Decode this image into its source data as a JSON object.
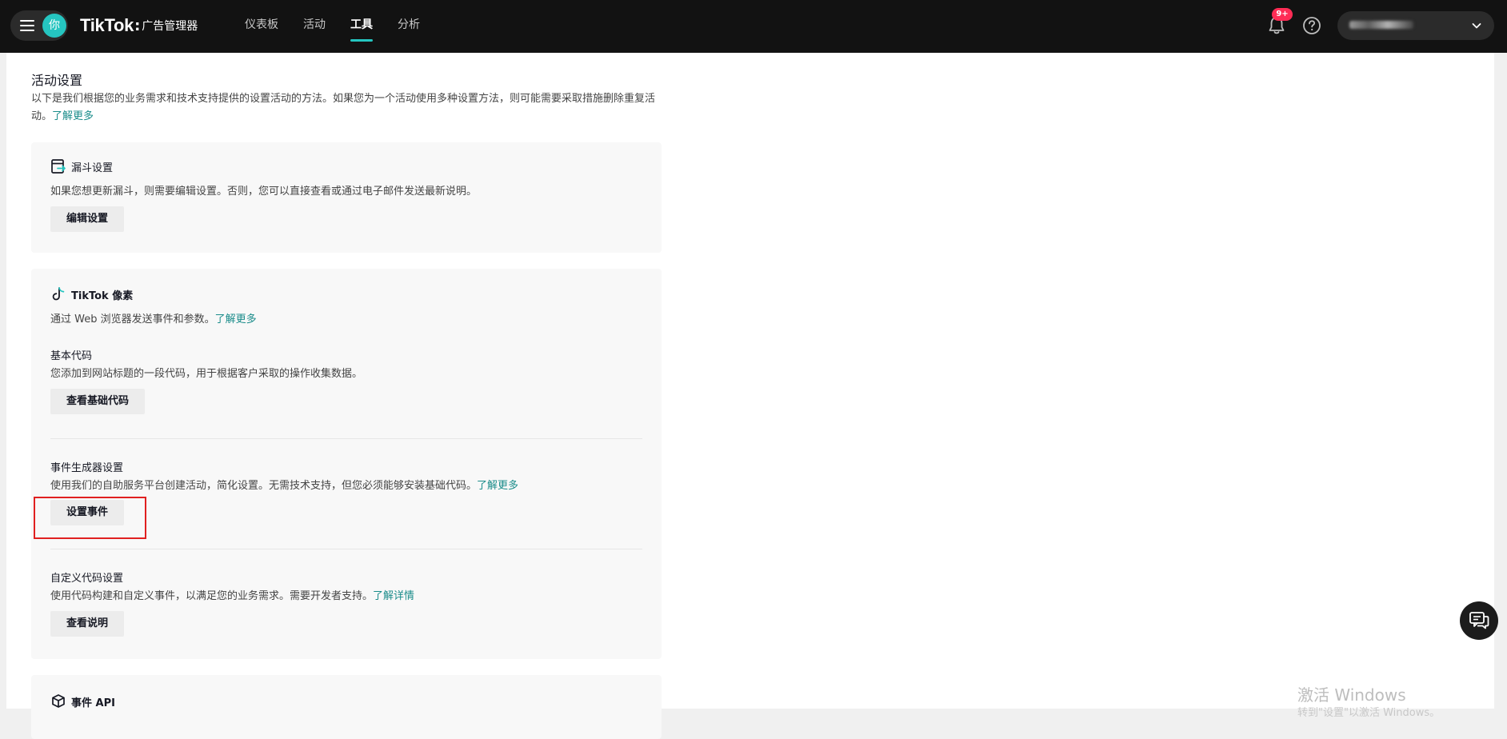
{
  "topbar": {
    "avatar_char": "你",
    "brand": "TikTok",
    "brand_colon": ":",
    "brand_sub": "广告管理器",
    "nav": [
      "仪表板",
      "活动",
      "工具",
      "分析"
    ],
    "active_nav": "工具",
    "badge": "9+",
    "accent_color": "#25c5c0"
  },
  "page": {
    "title": "活动设置",
    "desc": "以下是我们根据您的业务需求和技术支持提供的设置活动的方法。如果您为一个活动使用多种设置方法，则可能需要采取措施删除重复活动。",
    "desc_link": "了解更多"
  },
  "funnel_card": {
    "title": "漏斗设置",
    "desc": "如果您想更新漏斗，则需要编辑设置。否则，您可以直接查看或通过电子邮件发送最新说明。",
    "button": "编辑设置"
  },
  "pixel_card": {
    "title": "TikTok 像素",
    "desc": "通过 Web 浏览器发送事件和参数。",
    "desc_link": "了解更多",
    "base_code": {
      "title": "基本代码",
      "desc": "您添加到网站标题的一段代码，用于根据客户采取的操作收集数据。",
      "button": "查看基础代码"
    },
    "event_builder": {
      "title": "事件生成器设置",
      "desc": "使用我们的自助服务平台创建活动，简化设置。无需技术支持，但您必须能够安装基础代码。",
      "link": "了解更多",
      "button": "设置事件"
    },
    "custom_code": {
      "title": "自定义代码设置",
      "desc": "使用代码构建和自定义事件，以满足您的业务需求。需要开发者支持。",
      "link": "了解详情",
      "button": "查看说明"
    }
  },
  "events_api_card": {
    "title": "事件 API"
  },
  "watermark": {
    "line1": "激活 Windows",
    "line2": "转到\"设置\"以激活 Windows。"
  }
}
